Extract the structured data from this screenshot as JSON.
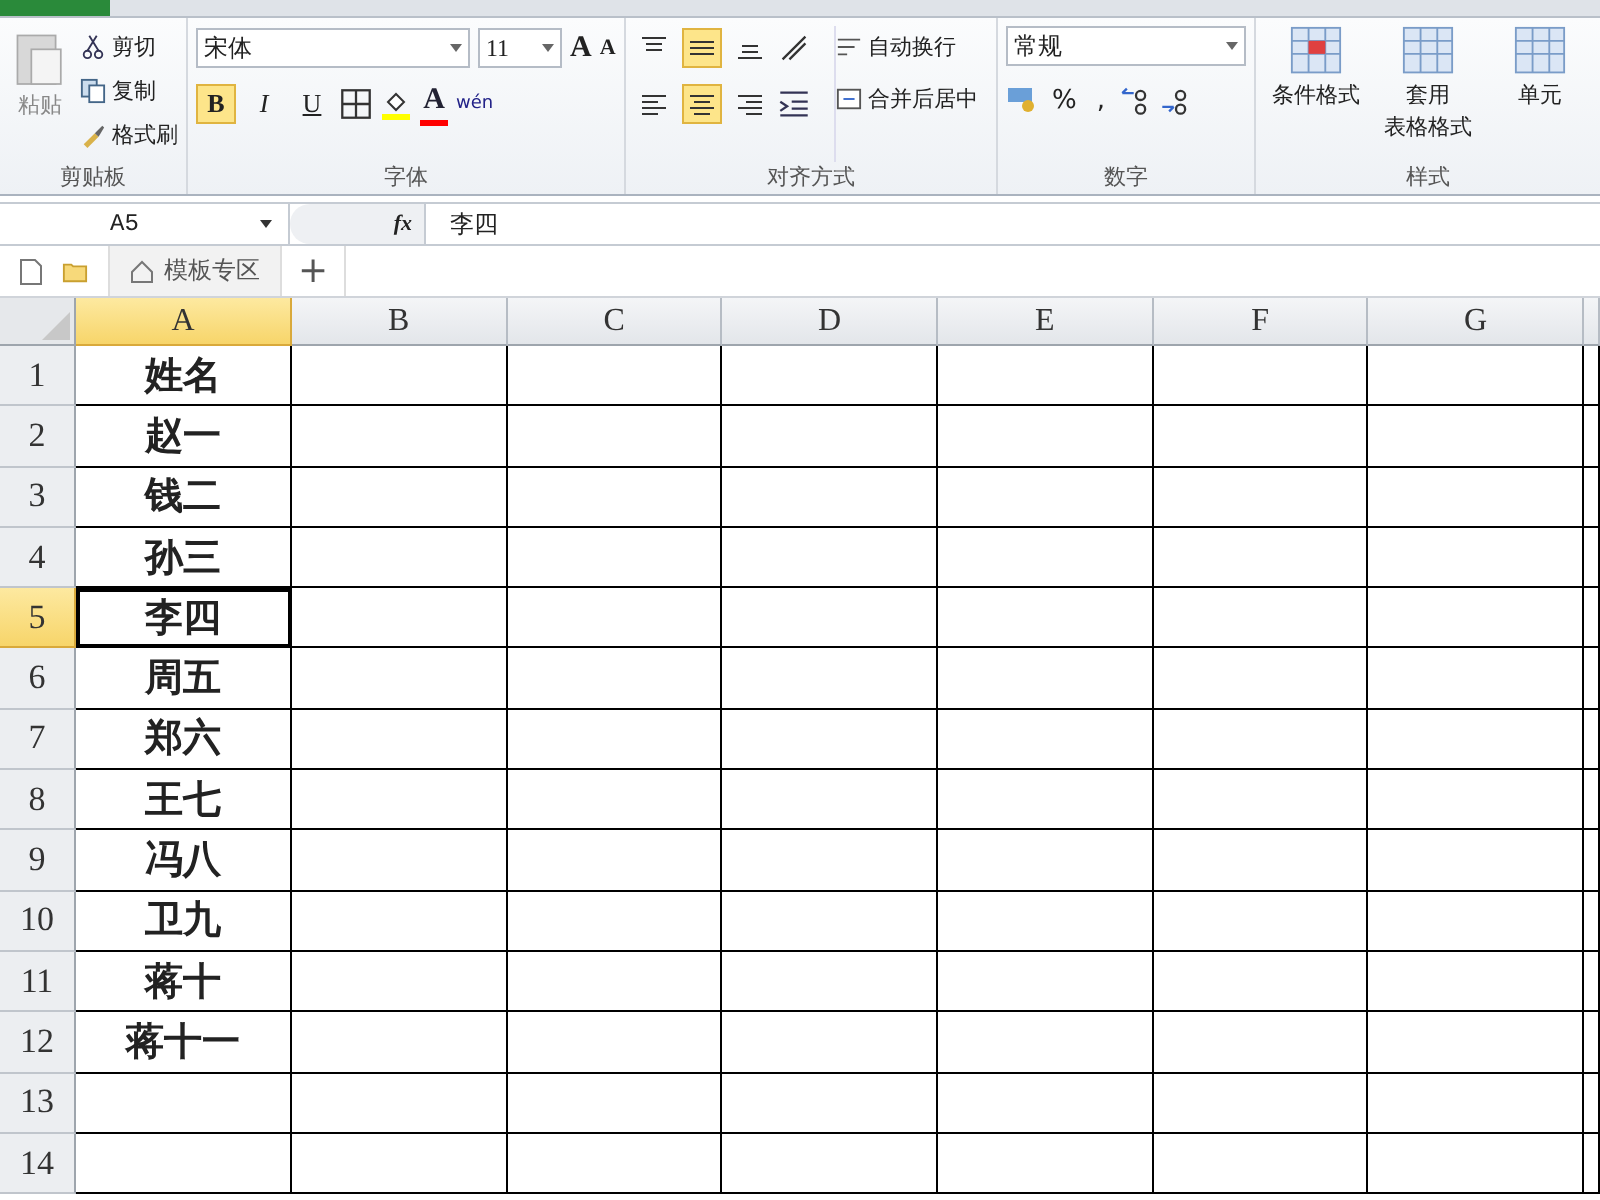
{
  "ribbon": {
    "clipboard": {
      "paste": "粘贴",
      "items": [
        {
          "label": "剪切",
          "kind": "cut"
        },
        {
          "label": "复制",
          "kind": "copy"
        },
        {
          "label": "格式刷",
          "kind": "brush"
        }
      ],
      "label": "剪贴板"
    },
    "font": {
      "font_name": "宋体",
      "font_size": "11",
      "grow": "A",
      "shrink": "A",
      "styles": [
        {
          "label": "B",
          "kind": "bold",
          "selected": true
        },
        {
          "label": "I",
          "kind": "italic",
          "selected": false
        },
        {
          "label": "U",
          "kind": "underline",
          "selected": false
        }
      ],
      "text_color_label": "A",
      "phonetic": "wén",
      "label": "字体"
    },
    "alignment": {
      "vertical": [
        {
          "kind": "top",
          "selected": false
        },
        {
          "kind": "middle",
          "selected": true
        },
        {
          "kind": "bottom",
          "selected": false
        }
      ],
      "horizontal": [
        {
          "kind": "left",
          "selected": false
        },
        {
          "kind": "center",
          "selected": true
        },
        {
          "kind": "right",
          "selected": false
        }
      ],
      "wrap": "自动换行",
      "merge": "合并后居中",
      "label": "对齐方式"
    },
    "number": {
      "format": "常规",
      "percent": "%",
      "comma": ",",
      "label": "数字"
    },
    "styles": {
      "items": [
        {
          "lines": [
            "条件格式"
          ]
        },
        {
          "lines": [
            "套用",
            "表格格式"
          ]
        },
        {
          "lines": [
            "单元"
          ]
        }
      ],
      "label": "样式"
    }
  },
  "formula_bar": {
    "name_box": "A5",
    "fx": "fx",
    "value": "李四"
  },
  "tabs": [
    {
      "label": "模板专区"
    }
  ],
  "new_tab": "+",
  "sheet": {
    "columns": [
      {
        "label": "A",
        "selected": true
      },
      {
        "label": "B",
        "selected": false
      },
      {
        "label": "C",
        "selected": false
      },
      {
        "label": "D",
        "selected": false
      },
      {
        "label": "E",
        "selected": false
      },
      {
        "label": "F",
        "selected": false
      },
      {
        "label": "G",
        "selected": false
      }
    ],
    "rows": [
      {
        "number": "1",
        "a": "姓名",
        "selected": false
      },
      {
        "number": "2",
        "a": "赵一",
        "selected": false
      },
      {
        "number": "3",
        "a": "钱二",
        "selected": false
      },
      {
        "number": "4",
        "a": "孙三",
        "selected": false
      },
      {
        "number": "5",
        "a": "李四",
        "selected": true
      },
      {
        "number": "6",
        "a": "周五",
        "selected": false
      },
      {
        "number": "7",
        "a": "郑六",
        "selected": false
      },
      {
        "number": "8",
        "a": "王七",
        "selected": false
      },
      {
        "number": "9",
        "a": "冯八",
        "selected": false
      },
      {
        "number": "10",
        "a": "卫九",
        "selected": false
      },
      {
        "number": "11",
        "a": "蒋十",
        "selected": false
      },
      {
        "number": "12",
        "a": "蒋十一",
        "selected": false
      },
      {
        "number": "13",
        "selected": false
      },
      {
        "number": "14",
        "selected": false
      }
    ]
  }
}
